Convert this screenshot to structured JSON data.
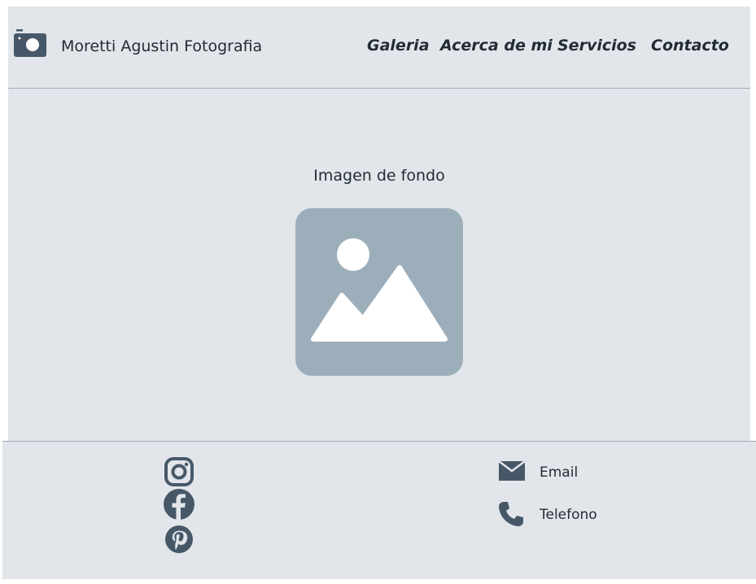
{
  "header": {
    "brand": "Moretti Agustin Fotografia",
    "logo_icon": "camera-icon",
    "nav": [
      "Galeria",
      "Acerca de mi",
      "Servicios",
      "Contacto"
    ]
  },
  "main": {
    "background_label": "Imagen de fondo",
    "placeholder_icon": "image-placeholder-icon"
  },
  "footer": {
    "social": [
      "instagram-icon",
      "facebook-icon",
      "pinterest-icon"
    ],
    "contact": {
      "email_label": "Email",
      "phone_label": "Telefono"
    }
  },
  "colors": {
    "panel": "#e2e6ea",
    "divider": "#9aacbb",
    "icon_dark": "#465868",
    "placeholder": "#9daebb",
    "text": "#222b36"
  }
}
